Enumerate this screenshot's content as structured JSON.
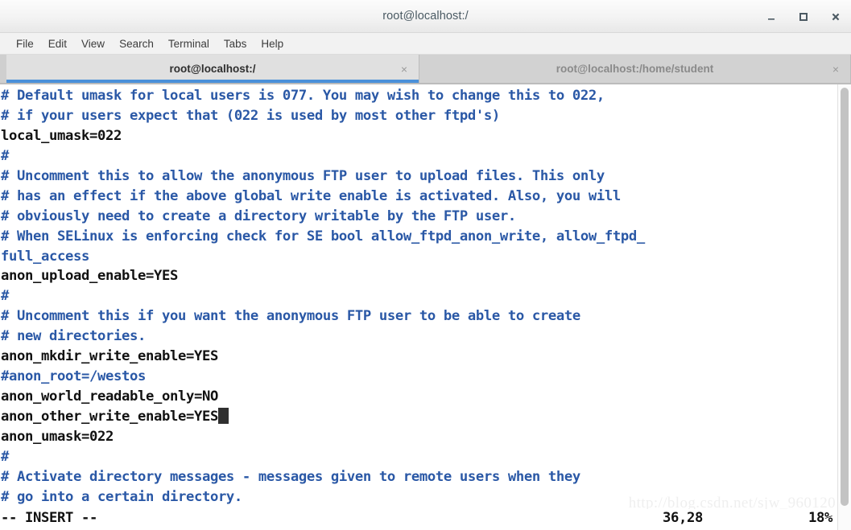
{
  "window": {
    "title": "root@localhost:/",
    "controls": [
      {
        "name": "minimize-button",
        "glyph": "_"
      },
      {
        "name": "maximize-button",
        "glyph": "□"
      },
      {
        "name": "close-button",
        "glyph": "×"
      }
    ]
  },
  "menubar": {
    "items": [
      {
        "label": "File"
      },
      {
        "label": "Edit"
      },
      {
        "label": "View"
      },
      {
        "label": "Search"
      },
      {
        "label": "Terminal"
      },
      {
        "label": "Tabs"
      },
      {
        "label": "Help"
      }
    ]
  },
  "tabs": [
    {
      "label": "root@localhost:/",
      "active": true,
      "close_glyph": "×"
    },
    {
      "label": "root@localhost:/home/student",
      "active": false,
      "close_glyph": "×"
    }
  ],
  "terminal": {
    "lines": [
      {
        "text": "# Default umask for local users is 077. You may wish to change this to 022,",
        "type": "comment"
      },
      {
        "text": "# if your users expect that (022 is used by most other ftpd's)",
        "type": "comment"
      },
      {
        "text": "local_umask=022",
        "type": "code"
      },
      {
        "text": "#",
        "type": "comment"
      },
      {
        "text": "# Uncomment this to allow the anonymous FTP user to upload files. This only",
        "type": "comment"
      },
      {
        "text": "# has an effect if the above global write enable is activated. Also, you will",
        "type": "comment"
      },
      {
        "text": "# obviously need to create a directory writable by the FTP user.",
        "type": "comment"
      },
      {
        "text": "# When SELinux is enforcing check for SE bool allow_ftpd_anon_write, allow_ftpd_",
        "type": "comment"
      },
      {
        "text": "full_access",
        "type": "comment"
      },
      {
        "text": "anon_upload_enable=YES",
        "type": "code"
      },
      {
        "text": "#",
        "type": "comment"
      },
      {
        "text": "# Uncomment this if you want the anonymous FTP user to be able to create",
        "type": "comment"
      },
      {
        "text": "# new directories.",
        "type": "comment"
      },
      {
        "text": "anon_mkdir_write_enable=YES",
        "type": "code"
      },
      {
        "text": "#anon_root=/westos",
        "type": "comment"
      },
      {
        "text": "anon_world_readable_only=NO",
        "type": "code"
      },
      {
        "text": "anon_other_write_enable=YES",
        "type": "code",
        "cursor": true
      },
      {
        "text": "anon_umask=022",
        "type": "code"
      },
      {
        "text": "#",
        "type": "comment"
      },
      {
        "text": "# Activate directory messages - messages given to remote users when they",
        "type": "comment"
      },
      {
        "text": "# go into a certain directory.",
        "type": "comment"
      }
    ],
    "status": {
      "mode": "-- INSERT --",
      "position": "36,28",
      "percent": "18%"
    },
    "watermark": "http://blog.csdn.net/sjw_960120"
  },
  "colors": {
    "comment": "#2a58a6",
    "code": "#111111",
    "tab_accent": "#4a90d9",
    "cursor": "#2f2f2f"
  }
}
